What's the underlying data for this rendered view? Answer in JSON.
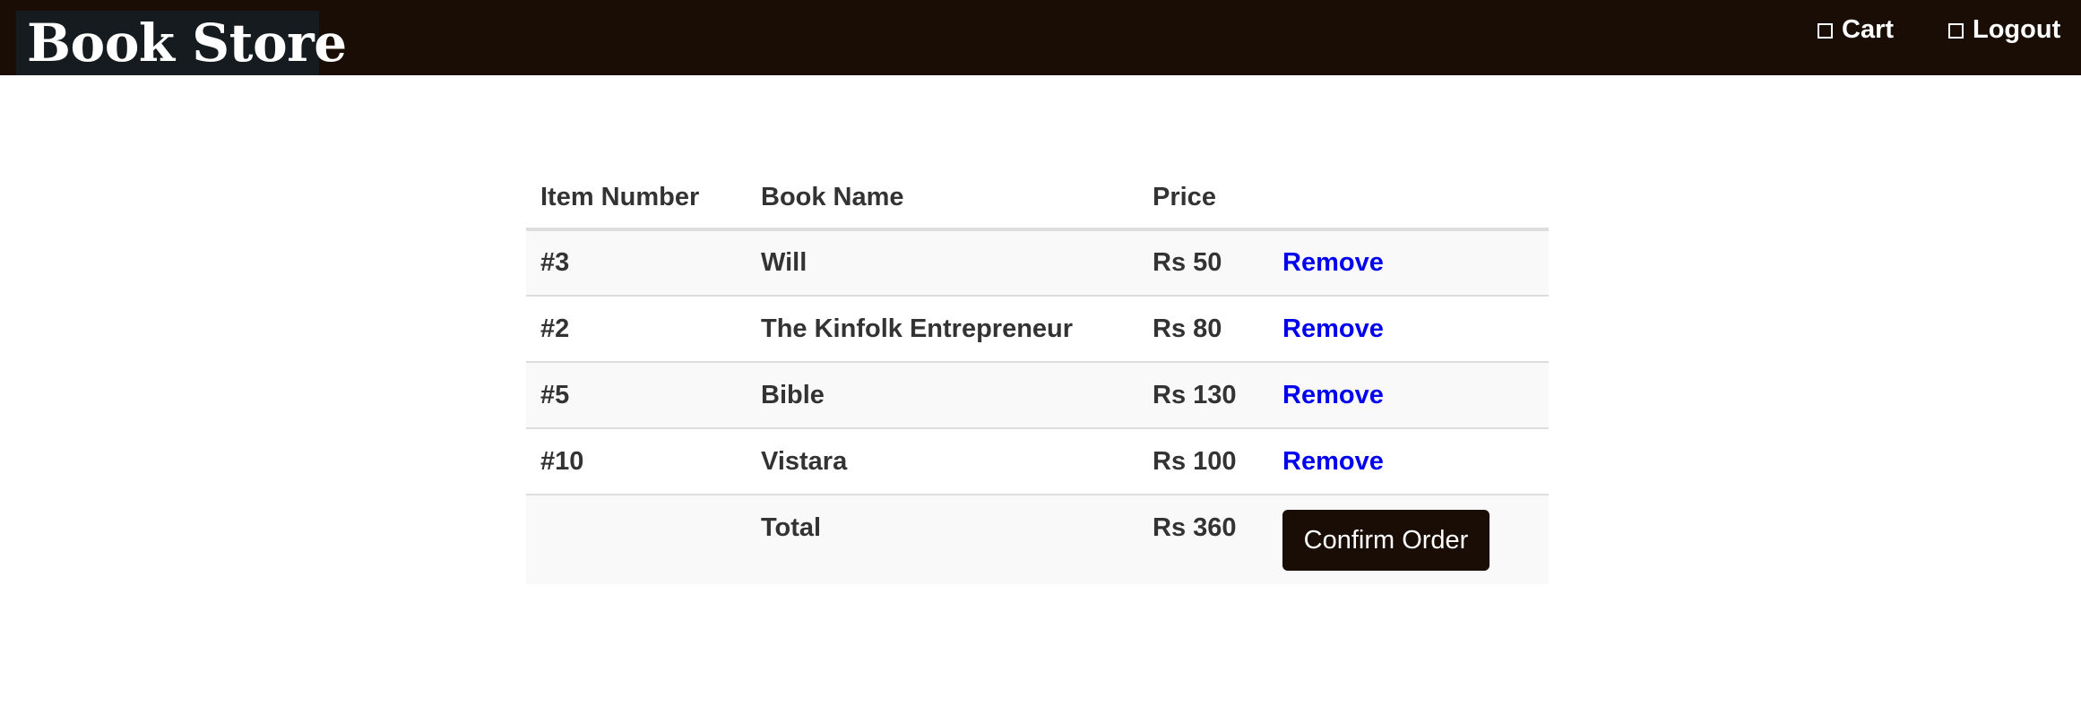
{
  "navbar": {
    "brand": "Book Store",
    "cart_label": "Cart",
    "logout_label": "Logout",
    "background_color": "#1a0d05"
  },
  "cart": {
    "headers": {
      "item_number": "Item Number",
      "book_name": "Book Name",
      "price": "Price"
    },
    "rows": [
      {
        "item_number": "#3",
        "book_name": "Will",
        "price": "Rs 50",
        "action": "Remove"
      },
      {
        "item_number": "#2",
        "book_name": "The Kinfolk Entrepreneur",
        "price": "Rs 80",
        "action": "Remove"
      },
      {
        "item_number": "#5",
        "book_name": "Bible",
        "price": "Rs 130",
        "action": "Remove"
      },
      {
        "item_number": "#10",
        "book_name": "Vistara",
        "price": "Rs 100",
        "action": "Remove"
      }
    ],
    "total": {
      "label": "Total",
      "price": "Rs 360",
      "confirm_label": "Confirm Order"
    },
    "link_color": "#0000ee"
  }
}
